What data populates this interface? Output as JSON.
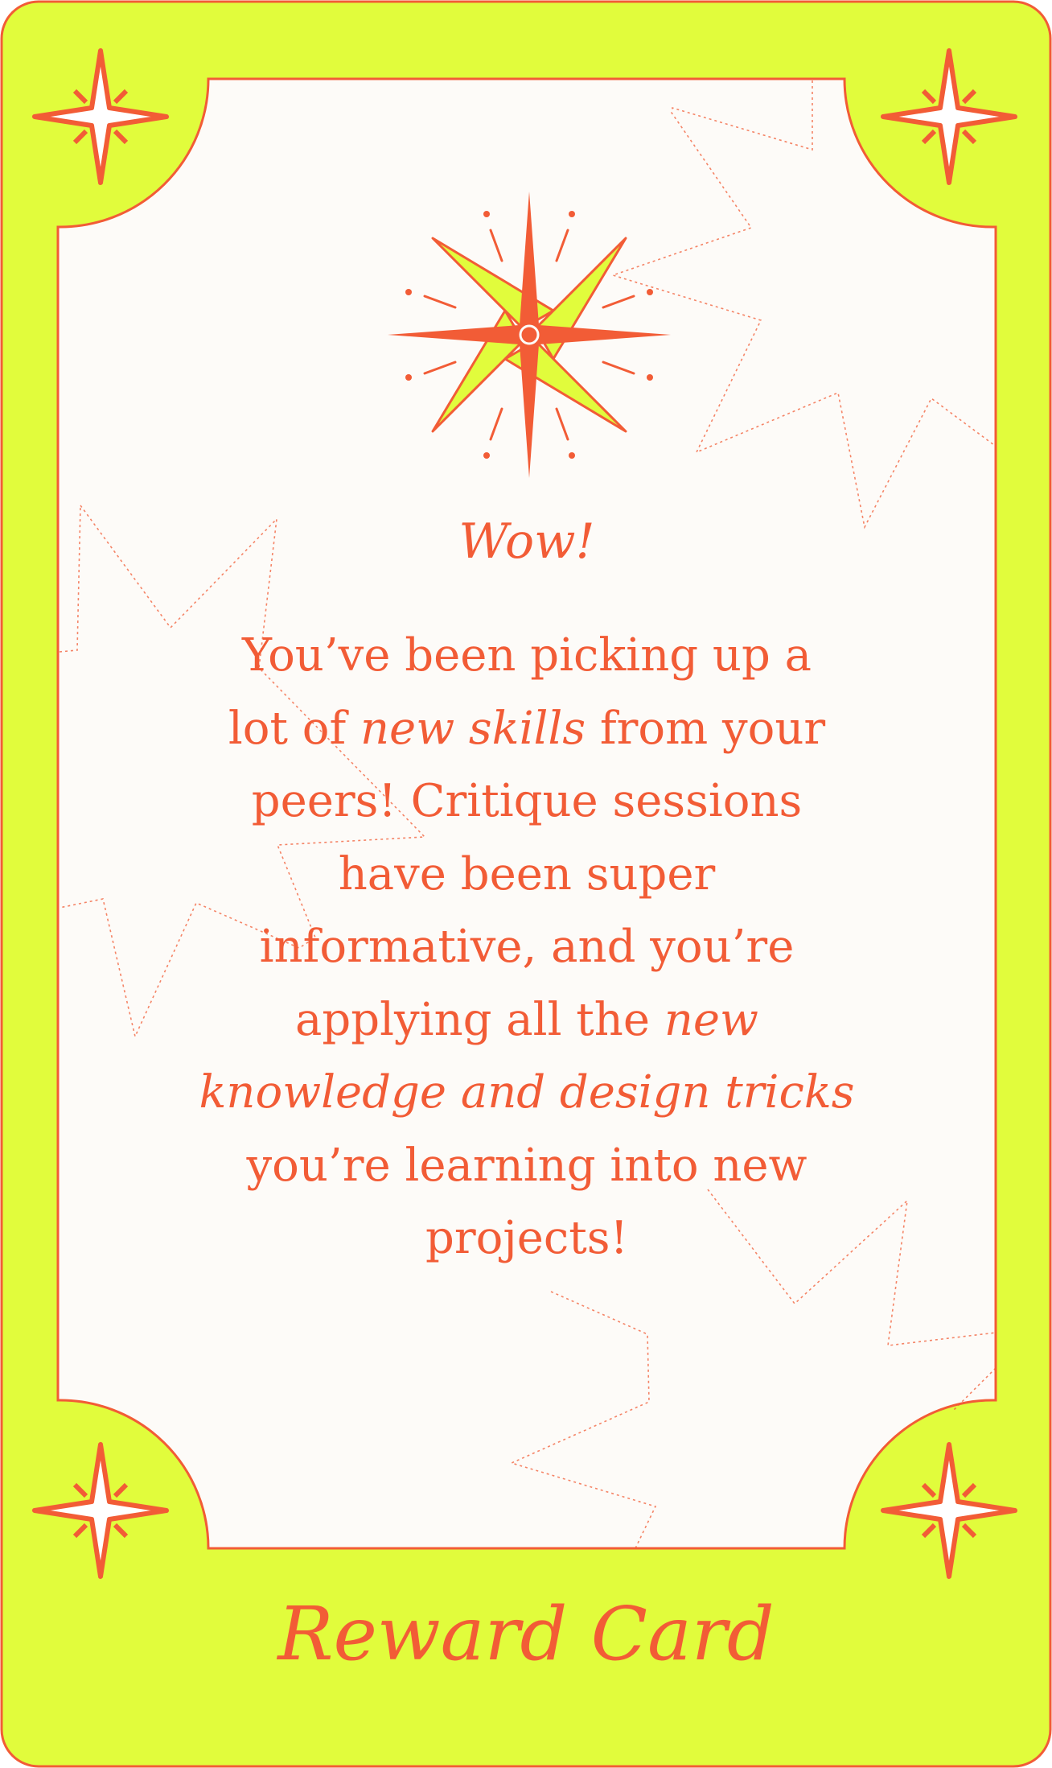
{
  "card": {
    "exclaim": "Wow!",
    "lines": [
      [
        {
          "t": "You’ve been picking up a",
          "i": false
        }
      ],
      [
        {
          "t": "lot of ",
          "i": false
        },
        {
          "t": "new skills",
          "i": true
        },
        {
          "t": " from your",
          "i": false
        }
      ],
      [
        {
          "t": "peers! Critique sessions",
          "i": false
        }
      ],
      [
        {
          "t": "have been super",
          "i": false
        }
      ],
      [
        {
          "t": "informative, and you’re",
          "i": false
        }
      ],
      [
        {
          "t": "applying all the ",
          "i": false
        },
        {
          "t": "new",
          "i": true
        }
      ],
      [
        {
          "t": "knowledge and design tricks",
          "i": true
        }
      ],
      [
        {
          "t": "you’re learning into new",
          "i": false
        }
      ],
      [
        {
          "t": "projects!",
          "i": false
        }
      ]
    ],
    "footer_title": "Reward Card"
  },
  "colors": {
    "border_fill": "#e1fc3c",
    "accent": "#f25c36",
    "panel": "#fdfbf8"
  },
  "icons": [
    "sparkle-icon",
    "compass-star-icon"
  ]
}
